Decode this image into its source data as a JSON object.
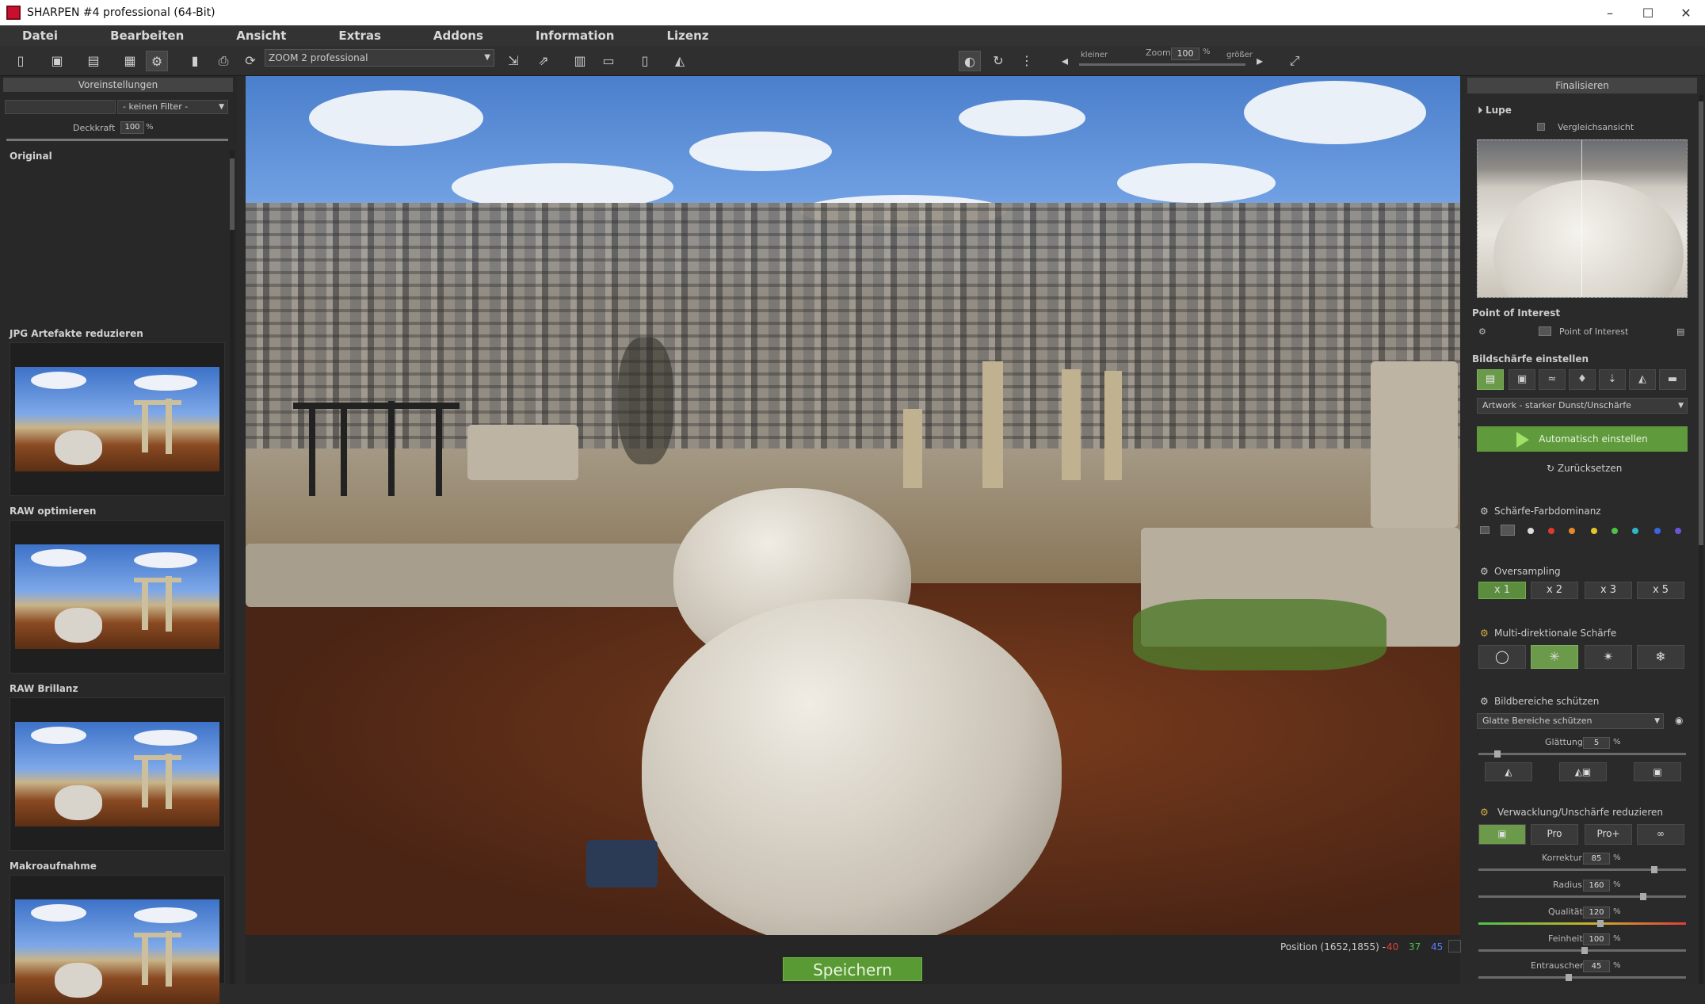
{
  "window": {
    "title": "SHARPEN #4 professional (64-Bit)",
    "minimize": "–",
    "maximize": "☐",
    "close": "✕"
  },
  "menu": [
    "Datei",
    "Bearbeiten",
    "Ansicht",
    "Extras",
    "Addons",
    "Information",
    "Lizenz"
  ],
  "toolbar": {
    "preset_select": "ZOOM 2 professional",
    "zoom_small": "kleiner",
    "zoom_label": "Zoom",
    "zoom_value": "100",
    "zoom_unit": "%",
    "zoom_big": "größer"
  },
  "left": {
    "header": "Voreinstellungen",
    "filter": "- keinen Filter -",
    "opacity_label": "Deckkraft",
    "opacity_value": "100",
    "opacity_unit": "%",
    "presets": [
      "Original",
      "JPG Artefakte reduzieren",
      "RAW optimieren",
      "RAW Brillanz",
      "Makroaufnahme"
    ]
  },
  "status": {
    "position": "Position  (1652,1855)  -",
    "r": "40",
    "g": "37",
    "b": "45",
    "save_label": "Speichern"
  },
  "right": {
    "header": "Finalisieren",
    "lupe": "Lupe",
    "compare": "Vergleichsansicht",
    "poi_title": "Point of Interest",
    "poi_item": "Point of Interest",
    "sharp_title": "Bildschärfe einstellen",
    "sharp_select": "Artwork - starker Dunst/Unschärfe",
    "auto_label": "Automatisch einstellen",
    "reset_label": "Zurücksetzen",
    "color_dom": "Schärfe-Farbdominanz",
    "oversampling": "Oversampling",
    "os_options": [
      "x 1",
      "x 2",
      "x 3",
      "x 5"
    ],
    "multidir": "Multi-direktionale Schärfe",
    "protect": "Bildbereiche schützen",
    "protect_select": "Glatte Bereiche schützen",
    "smooth_label": "Glättung",
    "smooth_value": "5",
    "shake": "Verwacklung/Unschärfe reduzieren",
    "shake_options": [
      "Pro",
      "Pro+"
    ],
    "korrektur_label": "Korrektur",
    "korrektur_value": "85",
    "radius_label": "Radius",
    "radius_value": "160",
    "qualitaet_label": "Qualität",
    "qualitaet_value": "120",
    "feinheit_label": "Feinheit",
    "feinheit_value": "100",
    "entrauschen_label": "Entrauschen",
    "entrauschen_value": "45",
    "unit": "%"
  },
  "colors": {
    "accent_green": "#5fcb38",
    "dom_dots": [
      "#dddddd",
      "#e03a2f",
      "#e9882b",
      "#e6c52a",
      "#4fc24a",
      "#2fb7c8",
      "#3a66e0",
      "#6a55d8"
    ]
  }
}
